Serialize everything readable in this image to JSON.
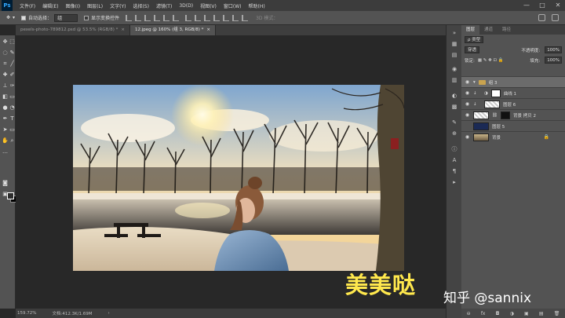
{
  "menubar": {
    "logo": "Ps",
    "items": [
      "文件(F)",
      "编辑(E)",
      "图像(I)",
      "图层(L)",
      "文字(Y)",
      "选择(S)",
      "滤镜(T)",
      "3D(D)",
      "视图(V)",
      "窗口(W)",
      "帮助(H)"
    ],
    "window_controls": [
      "—",
      "□",
      "✕"
    ]
  },
  "options": {
    "auto_select_label": "自动选择：",
    "auto_select_value": "组",
    "show_transform_label": "显示变换控件",
    "mode_3d_label": "3D 模式："
  },
  "tabs": [
    {
      "label": "pexels-photo-789812.psd @ 53.5% (RGB/8) *",
      "close": "×"
    },
    {
      "label": "12.jpeg @ 160% (组 3, RGB/8) *",
      "close": "×"
    }
  ],
  "status": {
    "zoom": "159.72%",
    "doc": "文档:412.3K/1.69M",
    "arrow": "›"
  },
  "panel": {
    "tabs": [
      "图层",
      "通道",
      "路径"
    ],
    "filter_label": "ρ 类型",
    "blend_mode": "穿透",
    "opacity_label": "不透明度:",
    "opacity_value": "100%",
    "lock_label": "锁定:",
    "fill_label": "填充:",
    "fill_value": "100%",
    "layers": [
      {
        "name": "组 3"
      },
      {
        "name": "曲线 1"
      },
      {
        "name": "图层 6"
      },
      {
        "name": "背景 拷贝 2"
      },
      {
        "name": "图层 5"
      },
      {
        "name": "背景"
      }
    ],
    "bottom_icons": [
      "⊖",
      "fx",
      "◘",
      "◑",
      "▣",
      "▤",
      "🗑"
    ]
  },
  "overlay": {
    "caption": "美美哒",
    "watermark": "知乎 @sannix"
  },
  "colors": {
    "caption": "#ffe84d",
    "app_bg": "#282828",
    "panel_bg": "#535353"
  }
}
